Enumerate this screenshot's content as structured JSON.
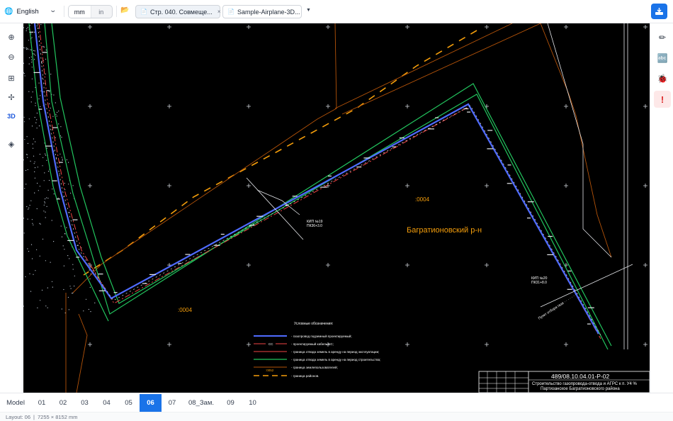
{
  "toolbar": {
    "language": "English",
    "units": [
      "mm",
      "in"
    ],
    "active_unit": "mm",
    "tabs": [
      {
        "label": "Стр. 040. Совмеще...",
        "active": true,
        "closable": true
      },
      {
        "label": "Sample-Airplane-3D...",
        "active": false,
        "closable": false
      }
    ],
    "icons": {
      "language": "globe-icon",
      "folder": "folder-icon",
      "export": "export-icon"
    }
  },
  "left_tools": [
    {
      "name": "zoom-in-icon",
      "glyph": "⊕"
    },
    {
      "name": "zoom-out-icon",
      "glyph": "⊖"
    },
    {
      "name": "zoom-extents-icon",
      "glyph": "⊞"
    },
    {
      "name": "pan-icon",
      "glyph": "✢"
    },
    {
      "name": "3d-view-button",
      "glyph": "3D"
    },
    {
      "name": "layers-icon",
      "glyph": "◈"
    }
  ],
  "right_tools": [
    {
      "name": "annotate-pencil-icon",
      "glyph": "✏"
    },
    {
      "name": "text-abc-icon",
      "glyph": "🔤"
    },
    {
      "name": "debug-bug-icon",
      "glyph": "🐞"
    },
    {
      "name": "warning-icon",
      "glyph": "!"
    }
  ],
  "drawing": {
    "district_label": "Багратионовский р-н",
    "parcel_label_1": ":0004",
    "parcel_label_2": ":0004",
    "legend_title": "Условные обозначения:",
    "legend_items": [
      "- газопровод подземный проектируемый;",
      "- проектируемый кабель СС;",
      "- граница отвода земель в аренду на период эксплуатации;",
      "- граница отвода земель в аренду на период строительства;",
      "- граница землепользователей;",
      "- граница районов."
    ],
    "legend_cable_code": "СС",
    "legend_parcel_code": ":0052",
    "stamp_code": "489/08.10.04.01-Р-02",
    "stamp_title_1": "Строительство газопровода-отвода и АГРС к п. У4 %",
    "stamp_title_2": "Партизанское Багратионовского района",
    "pk_labels": [
      "КИП №19",
      "ПК36+3.0",
      "КИП №20",
      "ПК31+8.0"
    ],
    "colors": {
      "background": "#000000",
      "pipeline": "#3b5bff",
      "land_operation": "#ff3b3b",
      "land_construction": "#22c55e",
      "land_users": "#f59e0b",
      "district": "#f59e0b",
      "text": "#ffffff"
    }
  },
  "layouts": {
    "tabs": [
      "Model",
      "01",
      "02",
      "03",
      "04",
      "05",
      "06",
      "07",
      "08_Зам.",
      "09",
      "10"
    ],
    "active": "06"
  },
  "status": {
    "layout_text": "Layout: 06",
    "size_text": "7255 × 8152 mm"
  }
}
